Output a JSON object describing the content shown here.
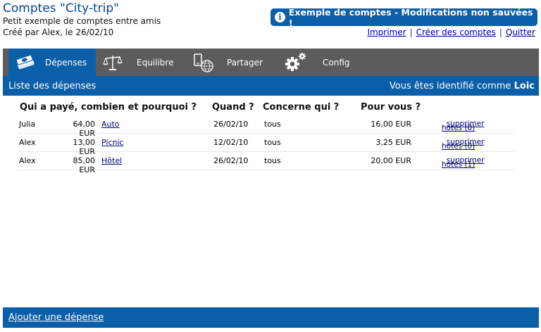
{
  "header": {
    "title": "Comptes \"City-trip\"",
    "subtitle": "Petit exemple de comptes entre amis",
    "created": "Créé par Alex, le 26/02/10"
  },
  "notice": {
    "icon": "info-icon",
    "text": "Exemple de comptes - Modifications non sauvées !"
  },
  "top_links": {
    "print": "Imprimer",
    "create": "Créer des comptes",
    "quit": "Quitter",
    "separator": "|"
  },
  "nav": {
    "tabs": [
      {
        "label": "Dépenses",
        "icon": "money-stack-icon",
        "active": true
      },
      {
        "label": "Equilibre",
        "icon": "balance-scale-icon",
        "active": false
      },
      {
        "label": "Partager",
        "icon": "share-phone-globe-icon",
        "active": false
      },
      {
        "label": "Config",
        "icon": "gears-icon",
        "active": false
      }
    ]
  },
  "section": {
    "title": "Liste des dépenses",
    "identity_prefix": "Vous êtes identifié comme",
    "user": "Loic"
  },
  "table": {
    "headers": {
      "who": "Qui a payé, combien et pourquoi ?",
      "when": "Quand ?",
      "concerns": "Concerne qui ?",
      "for_you": "Pour vous ?"
    },
    "rows": [
      {
        "payer": "Julia",
        "amount": "64,00 EUR",
        "reason": "Auto",
        "date": "26/02/10",
        "concerne": "tous",
        "share": "16,00 EUR",
        "notes": "notes (0)",
        "comma": ",",
        "delete": "supprimer"
      },
      {
        "payer": "Alex",
        "amount": "13,00 EUR",
        "reason": "Picnic",
        "date": "12/02/10",
        "concerne": "tous",
        "share": "3,25 EUR",
        "notes": "notes (0)",
        "comma": ",",
        "delete": "supprimer"
      },
      {
        "payer": "Alex",
        "amount": "85,00 EUR",
        "reason": "Hôtel",
        "date": "26/02/10",
        "concerne": "tous",
        "share": "20,00 EUR",
        "notes": "notes (1)",
        "comma": ",",
        "delete": "supprimer"
      }
    ]
  },
  "footer": {
    "add_link": "Ajouter une dépense"
  },
  "colors": {
    "brand_blue": "#0b5ea8",
    "nav_grey": "#5c5c5c",
    "title_blue": "#00469b",
    "link": "#00007f"
  }
}
